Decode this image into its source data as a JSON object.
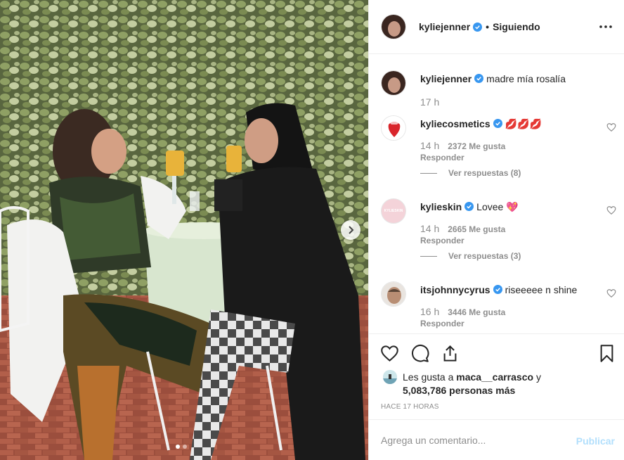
{
  "header": {
    "username": "kyliejenner",
    "separator": "•",
    "follow_status": "Siguiendo",
    "more_icon": "more-horizontal-icon"
  },
  "caption": {
    "username": "kyliejenner",
    "text": "madre mía rosalía",
    "time": "17 h"
  },
  "comments": [
    {
      "username": "kyliecosmetics",
      "text": "💋💋💋",
      "time": "14 h",
      "likes": "2372 Me gusta",
      "reply": "Responder",
      "view_replies": "Ver respuestas (8)"
    },
    {
      "username": "kylieskin",
      "text": "Lovee 💖",
      "time": "14 h",
      "likes": "2665 Me gusta",
      "reply": "Responder",
      "view_replies": "Ver respuestas (3)",
      "avatar_text": "KYLIESKIN"
    },
    {
      "username": "itsjohnnycyrus",
      "text": "riseeeee n shine",
      "time": "16 h",
      "likes": "3446 Me gusta",
      "reply": "Responder"
    }
  ],
  "actions": {
    "icons": [
      "heart-icon",
      "comment-icon",
      "share-icon",
      "bookmark-icon"
    ]
  },
  "likes": {
    "prefix": "Les gusta a",
    "user": "maca__carrasco",
    "conj": "y",
    "others": "5,083,786 personas más"
  },
  "time_ago": "HACE 17 HORAS",
  "add_comment": {
    "placeholder": "Agrega un comentario...",
    "publish_label": "Publicar"
  },
  "colors": {
    "verified": "#3897f0",
    "publish": "#b2dffc",
    "muted": "#8e8e8e"
  }
}
